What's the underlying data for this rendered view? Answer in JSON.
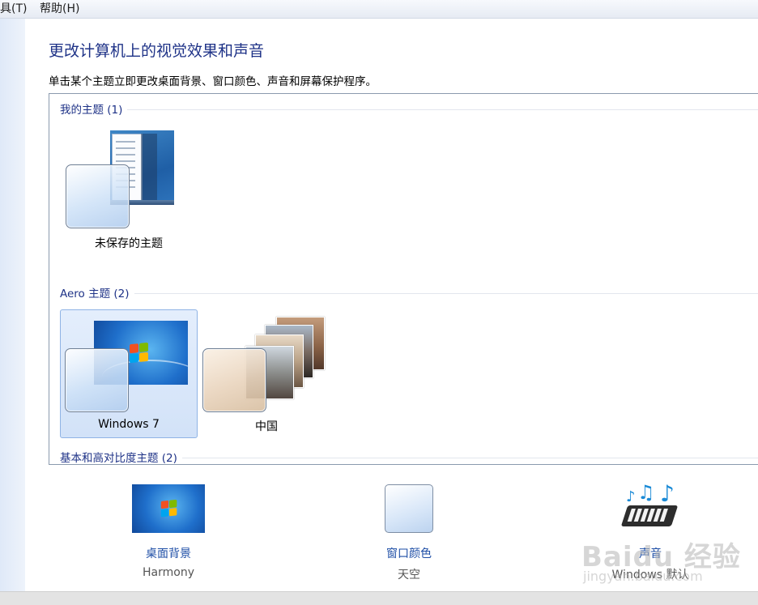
{
  "menubar": {
    "tools": "具(T)",
    "help": "帮助(H)"
  },
  "page": {
    "title": "更改计算机上的视觉效果和声音",
    "subtitle": "单击某个主题立即更改桌面背景、窗口颜色、声音和屏幕保护程序。"
  },
  "groups": {
    "my_themes": {
      "label": "我的主题 (1)",
      "items": [
        {
          "name": "未保存的主题"
        }
      ]
    },
    "aero": {
      "label": "Aero 主题 (2)",
      "items": [
        {
          "name": "Windows 7",
          "selected": true
        },
        {
          "name": "中国"
        }
      ]
    },
    "basic": {
      "label": "基本和高对比度主题 (2)"
    }
  },
  "controls": {
    "background": {
      "label": "桌面背景",
      "value": "Harmony"
    },
    "color": {
      "label": "窗口颜色",
      "value": "天空"
    },
    "sound": {
      "label": "声音",
      "value": "Windows 默认"
    }
  },
  "watermark": {
    "brand": "Baidu 经验",
    "url": "jingyan.baidu.com"
  },
  "colors": {
    "title": "#1e3287",
    "link": "#1e4ea6",
    "selected_bg": "#d8e6fa"
  }
}
